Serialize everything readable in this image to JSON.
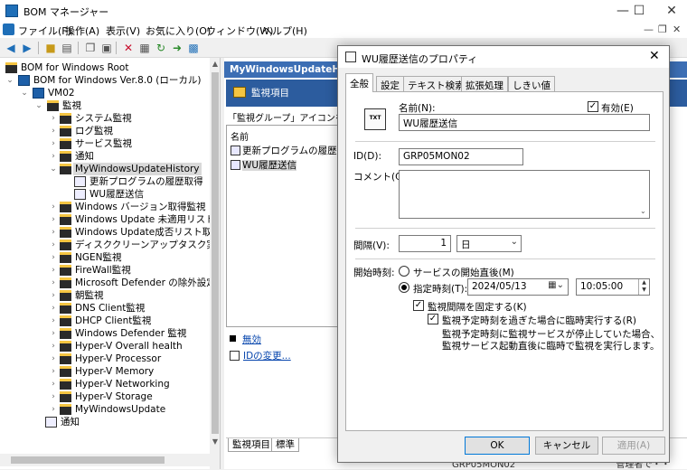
{
  "window": {
    "title": "BOM マネージャー",
    "controls": [
      "—",
      "☐",
      "✕"
    ]
  },
  "menu": {
    "items": [
      "ファイル(F)",
      "操作(A)",
      "表示(V)",
      "お気に入り(O)",
      "ウィンドウ(W)",
      "ヘルプ(H)"
    ],
    "mdi_controls": [
      "—",
      "❐",
      "✕"
    ]
  },
  "toolbar": {
    "icons": [
      "back-icon",
      "forward-icon",
      "up-folder-icon",
      "properties-icon",
      "copy-icon",
      "paste-icon",
      "delete-icon",
      "properties-sheet-icon",
      "refresh-icon",
      "export-icon",
      "help-icon"
    ]
  },
  "tree": {
    "items": [
      {
        "label": "BOM for Windows Root",
        "icon": "folder-icon"
      },
      {
        "label": "BOM for Windows Ver.8.0 (ローカル)",
        "icon": "computer-icon"
      },
      {
        "label": "VM02",
        "icon": "computer-icon"
      },
      {
        "label": "監視",
        "icon": "folder-icon"
      },
      {
        "label": "システム監視",
        "icon": "folder-icon"
      },
      {
        "label": "ログ監視",
        "icon": "folder-icon"
      },
      {
        "label": "サービス監視",
        "icon": "folder-icon"
      },
      {
        "label": "通知",
        "icon": "folder-icon"
      },
      {
        "label": "MyWindowsUpdateHistory",
        "icon": "folder-icon"
      },
      {
        "label": "更新プログラムの履歴取得",
        "icon": "tool-icon"
      },
      {
        "label": "WU履歴送信",
        "icon": "send-icon"
      },
      {
        "label": "Windows バージョン取得監視",
        "icon": "folder-icon"
      },
      {
        "label": "Windows Update 未適用リスト取得監",
        "icon": "folder-icon"
      },
      {
        "label": "Windows Update成否リスト取得",
        "icon": "folder-icon"
      },
      {
        "label": "ディスククリーンアップタスク実行",
        "icon": "folder-icon"
      },
      {
        "label": "NGEN監視",
        "icon": "folder-icon"
      },
      {
        "label": "FireWall監視",
        "icon": "folder-icon"
      },
      {
        "label": "Microsoft Defender の除外設定監視",
        "icon": "folder-icon"
      },
      {
        "label": "朝監視",
        "icon": "folder-icon"
      },
      {
        "label": "DNS Client監視",
        "icon": "folder-icon"
      },
      {
        "label": "DHCP Client監視",
        "icon": "folder-icon"
      },
      {
        "label": "Windows Defender 監視",
        "icon": "folder-icon"
      },
      {
        "label": "Hyper-V Overall health",
        "icon": "folder-icon"
      },
      {
        "label": "Hyper-V Processor",
        "icon": "folder-icon"
      },
      {
        "label": "Hyper-V Memory",
        "icon": "folder-icon"
      },
      {
        "label": "Hyper-V Networking",
        "icon": "folder-icon"
      },
      {
        "label": "Hyper-V Storage",
        "icon": "folder-icon"
      },
      {
        "label": "MyWindowsUpdate",
        "icon": "folder-icon"
      },
      {
        "label": "通知",
        "icon": "notify-icon"
      }
    ]
  },
  "right": {
    "header": "MyWindowsUpdateHistory",
    "sub_header": "監視項目",
    "description": "「監視グループ」アイコンを右クリッ",
    "list_header": "名前",
    "list_items": [
      "更新プログラムの履歴取得",
      "WU履歴送信"
    ],
    "tasks": [
      "無効",
      "IDの変更..."
    ],
    "bottom_tabs": [
      "監視項目",
      "標準"
    ],
    "status_text": "GRP05MON02",
    "status_right": "管理者で・・"
  },
  "dialog": {
    "title": "WU履歴送信のプロパティ",
    "tabs": [
      "全般",
      "設定",
      "テキスト検索",
      "拡張処理",
      "しきい値"
    ],
    "icon_text": "TXT",
    "name_label": "名前(N):",
    "name_value": "WU履歴送信",
    "enabled_label": "有効(E)",
    "id_label": "ID(D):",
    "id_value": "GRP05MON02",
    "comment_label": "コメント(C):",
    "comment_value": "",
    "interval_label": "間隔(V):",
    "interval_value": "1",
    "interval_unit": "日",
    "start_label": "開始時刻:",
    "radio_service": "サービスの開始直後(M)",
    "radio_time": "指定時刻(T):",
    "date_value": "2024/05/13",
    "time_value": "10:05:00",
    "fix_interval": "監視間隔を固定する(K)",
    "run_missed": "監視予定時刻を過ぎた場合に臨時実行する(R)",
    "note_line1": "監視予定時刻に監視サービスが停止していた場合、",
    "note_line2": "監視サービス起動直後に臨時で監視を実行します。",
    "ok": "OK",
    "cancel": "キャンセル",
    "apply": "適用(A)"
  }
}
